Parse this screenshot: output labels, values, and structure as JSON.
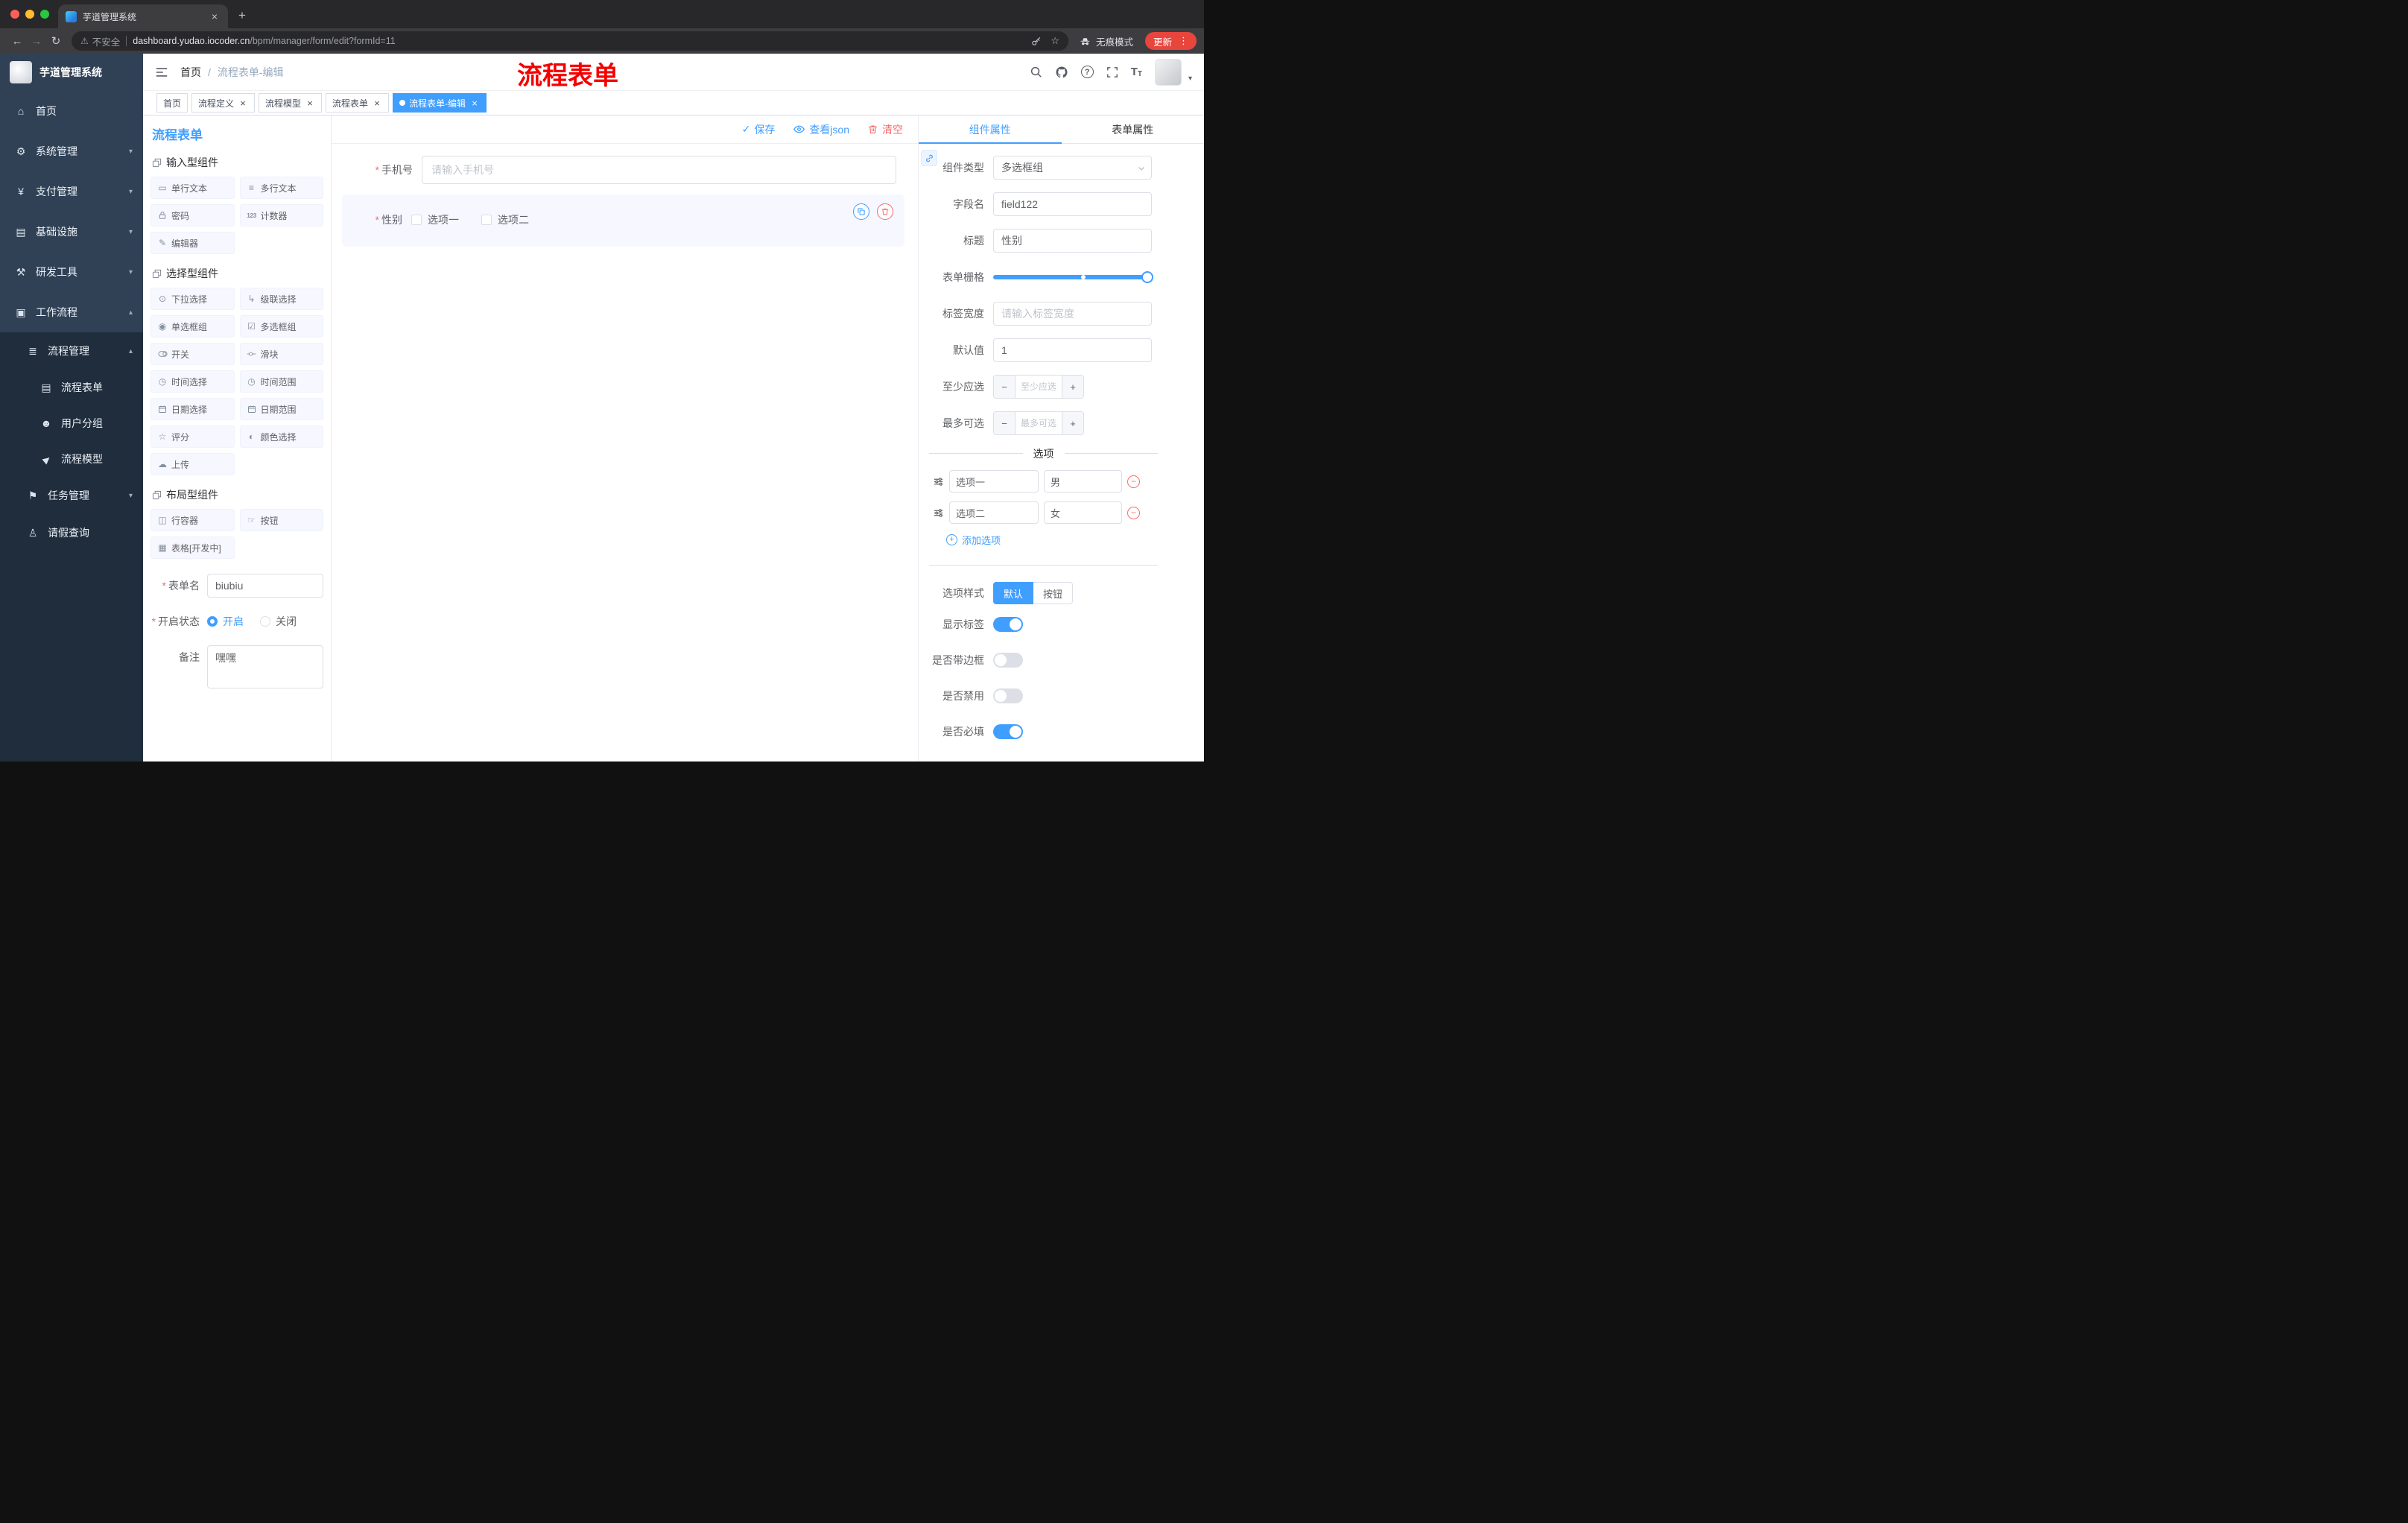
{
  "colors": {
    "primary": "#409eff",
    "danger": "#f56c6c",
    "annotation_red": "#f50000",
    "sidebar_bg": "#304156",
    "submenu_bg": "#1f2d3d"
  },
  "glyphs": {
    "close": "×",
    "plus": "+",
    "minus": "−",
    "back": "←",
    "forward": "→",
    "reload": "↻",
    "warning": "⚠",
    "menu_dots": "⋮",
    "caret_down": "▾",
    "caret_up": "▴",
    "check": "✓",
    "asterisk": "*",
    "breadcrumb_sep": "/",
    "star": "☆",
    "new_tab": "+"
  },
  "browser": {
    "tab_title": "芋道管理系统",
    "security_label": "不安全",
    "url_domain": "dashboard.yudao.iocoder.cn",
    "url_path": "/bpm/manager/form/edit?formId=11",
    "incognito_label": "无痕模式",
    "update_label": "更新"
  },
  "sidebar": {
    "logo_title": "芋道管理系统",
    "items": [
      {
        "label": "首页"
      },
      {
        "label": "系统管理"
      },
      {
        "label": "支付管理"
      },
      {
        "label": "基础设施"
      },
      {
        "label": "研发工具"
      },
      {
        "label": "工作流程"
      }
    ],
    "submenu": {
      "manage": {
        "label": "流程管理",
        "children": [
          {
            "label": "流程表单"
          },
          {
            "label": "用户分组"
          },
          {
            "label": "流程模型"
          }
        ]
      },
      "task": {
        "label": "任务管理"
      },
      "leave": {
        "label": "请假查询"
      }
    }
  },
  "header": {
    "breadcrumb": {
      "root": "首页",
      "current": "流程表单-编辑"
    },
    "annotation": "流程表单"
  },
  "tags": [
    {
      "label": "首页"
    },
    {
      "label": "流程定义"
    },
    {
      "label": "流程模型"
    },
    {
      "label": "流程表单"
    },
    {
      "label": "流程表单-编辑"
    }
  ],
  "palette": {
    "title": "流程表单",
    "groups": [
      {
        "title": "输入型组件",
        "items": [
          {
            "label": "单行文本"
          },
          {
            "label": "多行文本"
          },
          {
            "label": "密码"
          },
          {
            "label": "计数器"
          },
          {
            "label": "编辑器"
          }
        ]
      },
      {
        "title": "选择型组件",
        "items": [
          {
            "label": "下拉选择"
          },
          {
            "label": "级联选择"
          },
          {
            "label": "单选框组"
          },
          {
            "label": "多选框组"
          },
          {
            "label": "开关"
          },
          {
            "label": "滑块"
          },
          {
            "label": "时间选择"
          },
          {
            "label": "时间范围"
          },
          {
            "label": "日期选择"
          },
          {
            "label": "日期范围"
          },
          {
            "label": "评分"
          },
          {
            "label": "颜色选择"
          },
          {
            "label": "上传"
          }
        ]
      },
      {
        "title": "布局型组件",
        "items": [
          {
            "label": "行容器"
          },
          {
            "label": "按钮"
          },
          {
            "label": "表格[开发中]"
          }
        ]
      }
    ],
    "form": {
      "name_label": "表单名",
      "name_value": "biubiu",
      "status_label": "开启状态",
      "status_on": "开启",
      "status_off": "关闭",
      "remark_label": "备注",
      "remark_value": "嘿嘿"
    }
  },
  "canvas": {
    "toolbar": {
      "save": "保存",
      "view_json": "查看json",
      "clear": "清空"
    },
    "phone_field": {
      "label": "手机号",
      "placeholder": "请输入手机号"
    },
    "gender_field": {
      "label": "性别",
      "option1": "选项一",
      "option2": "选项二"
    }
  },
  "props": {
    "tabs": {
      "component": "组件属性",
      "form": "表单属性"
    },
    "component_type": {
      "label": "组件类型",
      "value": "多选框组"
    },
    "field_name": {
      "label": "字段名",
      "value": "field122"
    },
    "title": {
      "label": "标题",
      "value": "性别"
    },
    "grid": {
      "label": "表单栅格"
    },
    "label_width": {
      "label": "标签宽度",
      "placeholder": "请输入标签宽度"
    },
    "default_value": {
      "label": "默认值",
      "value": "1"
    },
    "min_select": {
      "label": "至少应选",
      "placeholder": "至少应选"
    },
    "max_select": {
      "label": "最多可选",
      "placeholder": "最多可选"
    },
    "options_title": "选项",
    "options": [
      {
        "label": "选项一",
        "value": "男"
      },
      {
        "label": "选项二",
        "value": "女"
      }
    ],
    "add_option": "添加选项",
    "option_style": {
      "label": "选项样式",
      "default": "默认",
      "button": "按钮"
    },
    "toggles": {
      "show_label": {
        "label": "显示标签",
        "on": true
      },
      "border": {
        "label": "是否带边框",
        "on": false
      },
      "disabled": {
        "label": "是否禁用",
        "on": false
      },
      "required": {
        "label": "是否必填",
        "on": true
      }
    }
  }
}
